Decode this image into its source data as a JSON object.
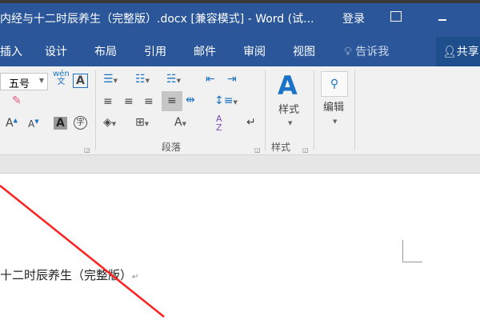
{
  "window": {
    "title": "内经与十二时辰养生（完整版）.docx [兼容模式] - Word (试...",
    "login": "登录",
    "ribbon_options_icon": "ribbon-display-icon",
    "minimize_icon": "minimize-icon"
  },
  "tabs": [
    {
      "label": "插入"
    },
    {
      "label": "设计"
    },
    {
      "label": "布局"
    },
    {
      "label": "引用"
    },
    {
      "label": "邮件"
    },
    {
      "label": "审阅"
    },
    {
      "label": "视图"
    }
  ],
  "tell_me": "告诉我",
  "share": "共享",
  "ribbon": {
    "font_size": "五号",
    "phonetic": "wén",
    "phonetic_char": "文",
    "paragraph_group": "段落",
    "styles_button": "样式",
    "styles_group": "样式",
    "edit_button": "编辑"
  },
  "document": {
    "text": "十二时辰养生（完整版）",
    "paragraph_mark": "↵"
  },
  "colors": {
    "brand": "#2b579a",
    "share_bg": "#1e4e8c",
    "annotation": "#ff2020"
  }
}
